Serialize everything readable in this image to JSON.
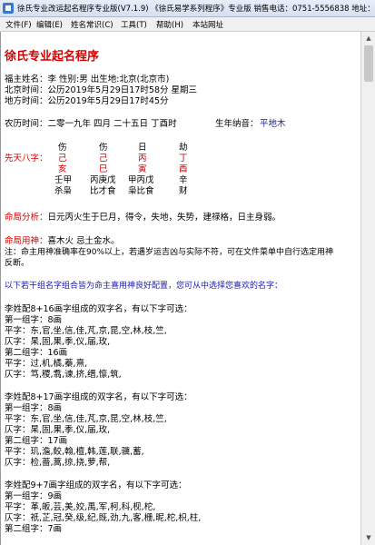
{
  "window": {
    "title": "徐氏专业改运起名程序专业版(V7.1.9) 《徐氏易学系列程序》专业版  销售电话：0751-5556838  地址："
  },
  "menu": [
    "文件(F)",
    "编辑(E)",
    "姓名常识(C)",
    "工具(T)",
    "帮助(H)",
    "本站网址"
  ],
  "report": {
    "heading": "徐氏专业起名程序",
    "info": [
      "福主姓名：李 性别:男  出生地:北京(北京市)",
      "北京时间：公历2019年5月29日17时58分 星期三",
      "地方时间：公历2019年5月29日17时45分"
    ],
    "lunar": {
      "label": "农历时间：",
      "text": "二零一九年 四月 二十五日 丁酉时",
      "nayin_label": "生年纳音：",
      "nayin": "平地木"
    },
    "bazi": {
      "label": "先天八字：",
      "gods": [
        "伤",
        "伤",
        "日",
        "劫"
      ],
      "stems": [
        "己",
        "己",
        "丙",
        "丁"
      ],
      "branches": [
        "亥",
        "巳",
        "寅",
        "酉"
      ],
      "hidden": [
        "壬甲",
        "丙庚戊",
        "甲丙戊",
        "辛"
      ],
      "hidden_gods": [
        "杀枭",
        "比才食",
        "枭比食",
        "财"
      ]
    },
    "analysis": {
      "label": "命局分析：",
      "text": "日元丙火生于巳月，得令，失地，失势，建禄格，日主身弱。"
    },
    "yongshen": {
      "label": "命局用神：",
      "text": "喜木火 忌土金水。"
    },
    "note": [
      "注：命主用神准确率在90%以上，若遇岁运吉凶与实际不符，可在文件菜单中自行选定用神",
      "反断。"
    ],
    "suggestion": "以下若干组名字组合皆为命主喜用神良好配置，您可从中选择您喜欢的名字：",
    "groups": [
      {
        "header": "李姓配8+16画字组成的双字名，有以下字可选：",
        "lines": [
          "第一组字：8画",
          "平字：东,官,坐,信,佳,芃,京,昆,空,林,枝,竺,",
          "仄字：杲,固,果,季,仪,届,玫,",
          "第二组字：16画",
          "平字：过,机,橘,蓁,熹,",
          "仄字：笃,稷,翥,谏,挤,缙,懔,筑,"
        ]
      },
      {
        "header": "李姓配8+17画字组成的双字名，有以下字可选：",
        "lines": [
          "第一组字：8画",
          "平字：东,官,坐,信,佳,芃,京,昆,空,林,枝,竺,",
          "仄字：杲,固,果,季,仪,届,玫,",
          "第二组字：17画",
          "平字：玑,澹,鲛,翰,檀,韩,莲,联,骥,蓄,",
          "仄字：检,蔷,蒿,掠,挠,萝,帮,"
        ]
      },
      {
        "header": "李姓配9+7画字组成的双字名，有以下字可选：",
        "lines": [
          "第一组字：9画",
          "平字：革,皈,芸,美,姣,禹,军,柯,科,枧,柁,",
          "仄字：祇,芷,冠,癸,级,纪,既,劲,九,客,栅,昵,柁,枳,柱,",
          "第二组字：7画"
        ]
      }
    ]
  }
}
